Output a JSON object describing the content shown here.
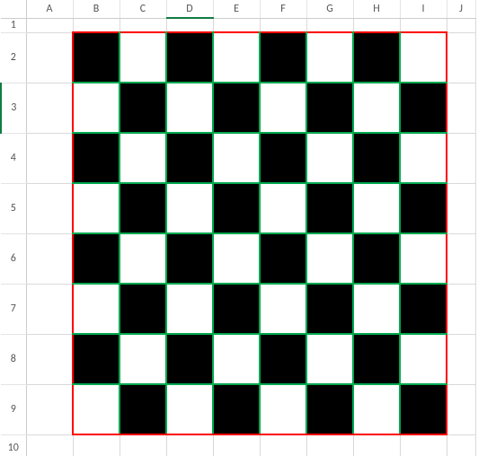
{
  "columns": [
    "A",
    "B",
    "C",
    "D",
    "E",
    "F",
    "G",
    "H",
    "I",
    "J"
  ],
  "rows": [
    "1",
    "2",
    "3",
    "4",
    "5",
    "6",
    "7",
    "8",
    "9",
    "10"
  ],
  "active_column": "D",
  "active_row": "3",
  "board": {
    "range": "B2:I9",
    "outer_border_color": "#ff0000",
    "inner_border_color": "#00a84f",
    "fill_dark": "#000000",
    "fill_light": "#ffffff",
    "size": 8,
    "pattern": [
      [
        "black",
        "white",
        "black",
        "white",
        "black",
        "white",
        "black",
        "white"
      ],
      [
        "white",
        "black",
        "white",
        "black",
        "white",
        "black",
        "white",
        "black"
      ],
      [
        "black",
        "white",
        "black",
        "white",
        "black",
        "white",
        "black",
        "white"
      ],
      [
        "white",
        "black",
        "white",
        "black",
        "white",
        "black",
        "white",
        "black"
      ],
      [
        "black",
        "white",
        "black",
        "white",
        "black",
        "white",
        "black",
        "white"
      ],
      [
        "white",
        "black",
        "white",
        "black",
        "white",
        "black",
        "white",
        "black"
      ],
      [
        "black",
        "white",
        "black",
        "white",
        "black",
        "white",
        "black",
        "white"
      ],
      [
        "white",
        "black",
        "white",
        "black",
        "white",
        "black",
        "white",
        "black"
      ]
    ]
  }
}
